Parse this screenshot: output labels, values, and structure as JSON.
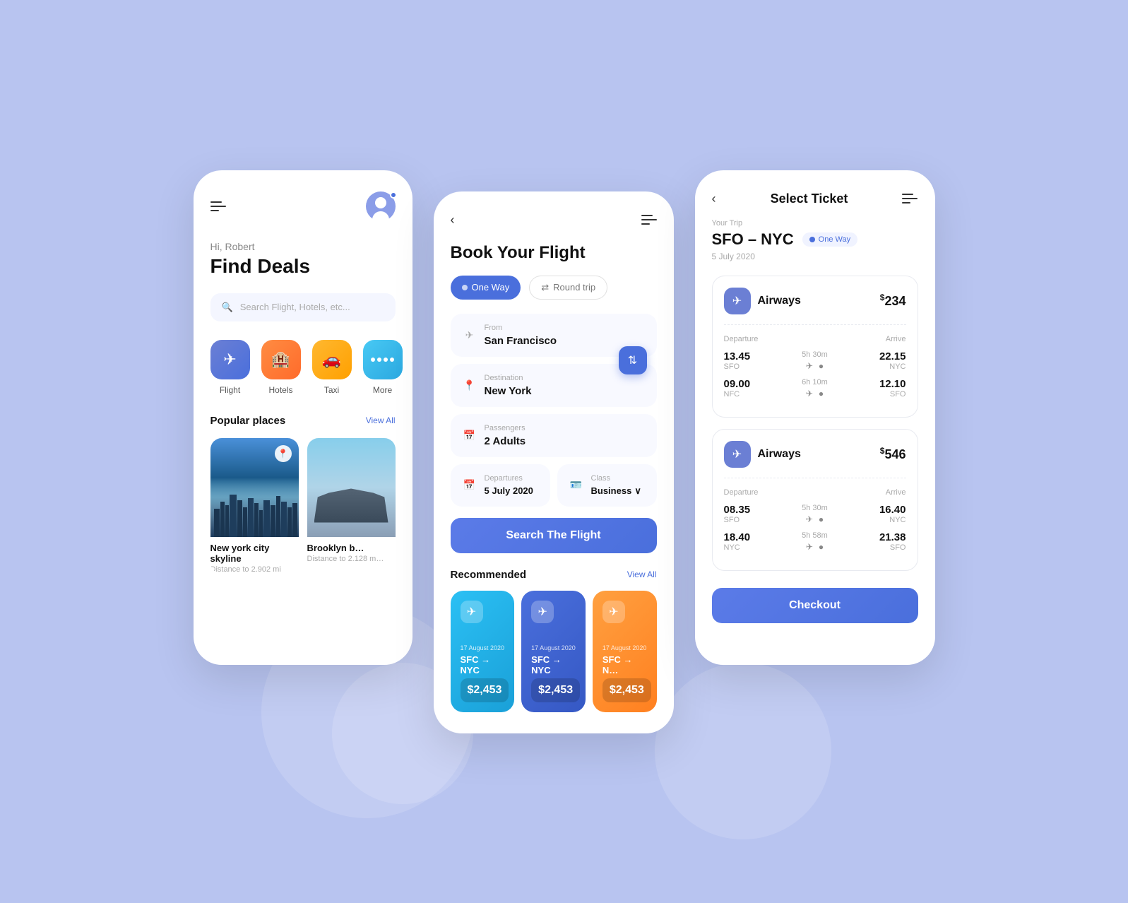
{
  "background": "#b8c4f0",
  "phone1": {
    "greeting": "Hi, Robert",
    "title": "Find Deals",
    "search_placeholder": "Search Flight, Hotels, etc...",
    "categories": [
      {
        "label": "Flight",
        "icon": "✈",
        "color": "bg-blue"
      },
      {
        "label": "Hotels",
        "icon": "🏨",
        "color": "bg-orange"
      },
      {
        "label": "Taxi",
        "icon": "🚗",
        "color": "bg-yellow"
      },
      {
        "label": "More",
        "icon": "···",
        "color": "bg-cyan"
      }
    ],
    "popular_title": "Popular places",
    "view_all": "View All",
    "places": [
      {
        "name": "New york city skyline",
        "distance": "Distance to 2.902 mi"
      },
      {
        "name": "Brooklyn b…",
        "distance": "Distance to 2.128 m…"
      }
    ]
  },
  "phone2": {
    "back": "‹",
    "menu": "≡",
    "title": "Book Your Flight",
    "tabs": [
      "One Way",
      "Round trip"
    ],
    "from_label": "From",
    "from_val": "San Francisco",
    "dest_label": "Destination",
    "dest_val": "New York",
    "passengers_label": "Passengers",
    "passengers_val": "2 Adults",
    "departures_label": "Departures",
    "departures_val": "5 July 2020",
    "class_label": "Class",
    "class_val": "Business",
    "search_btn": "Search The Flight",
    "recommended_title": "Recommended",
    "view_all": "View All",
    "rec_cards": [
      {
        "date": "17 August 2020",
        "route": "SFC → NYC",
        "price": "$2,453",
        "color": "rec-blue"
      },
      {
        "date": "17 August 2020",
        "route": "SFC → NYC",
        "price": "$2,453",
        "color": "rec-indigo"
      },
      {
        "date": "17 August 2020",
        "route": "SFC → N…",
        "price": "$2,453",
        "color": "rec-orange"
      }
    ]
  },
  "phone3": {
    "back": "‹",
    "menu": "≡",
    "title": "Select Ticket",
    "your_trip": "Your Trip",
    "route": "SFO – NYC",
    "badge": "One Way",
    "date": "5 July 2020",
    "airlines": [
      {
        "name": "Airways",
        "price": "$234",
        "flights": [
          {
            "dep_time": "13.45",
            "dep_code": "SFO",
            "duration": "5h 30m",
            "arr_time": "22.15",
            "arr_code": "NYC"
          },
          {
            "dep_time": "09.00",
            "dep_code": "NFC",
            "duration": "6h 10m",
            "arr_time": "12.10",
            "arr_code": "SFO"
          }
        ]
      },
      {
        "name": "Airways",
        "price": "$546",
        "flights": [
          {
            "dep_time": "08.35",
            "dep_code": "SFO",
            "duration": "5h 30m",
            "arr_time": "16.40",
            "arr_code": "NYC"
          },
          {
            "dep_time": "18.40",
            "dep_code": "NYC",
            "duration": "5h 58m",
            "arr_time": "21.38",
            "arr_code": "SFO"
          }
        ]
      }
    ],
    "departure_label": "Departure",
    "arrive_label": "Arrive",
    "checkout_btn": "Checkout"
  }
}
